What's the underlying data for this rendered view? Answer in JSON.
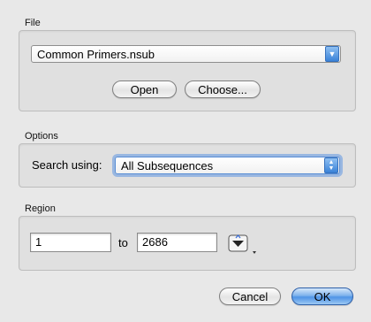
{
  "file": {
    "section_label": "File",
    "selected_file": "Common Primers.nsub",
    "open_label": "Open",
    "choose_label": "Choose..."
  },
  "options": {
    "section_label": "Options",
    "search_using_label": "Search using:",
    "search_using_value": "All Subsequences"
  },
  "region": {
    "section_label": "Region",
    "start_value": "1",
    "to_label": "to",
    "end_value": "2686"
  },
  "footer": {
    "cancel_label": "Cancel",
    "ok_label": "OK"
  },
  "colors": {
    "window_background": "#e8e8e8",
    "accent": "#4e94e6"
  },
  "icons": {
    "region_picker": "sequence-region-picker-icon",
    "popup_arrow": "chevron-down-icon",
    "stepper_arrows": "up-down-arrows-icon"
  }
}
